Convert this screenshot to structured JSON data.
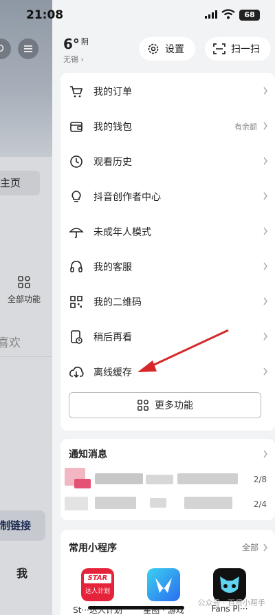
{
  "status_bar": {
    "time": "21:08",
    "battery": "68"
  },
  "left_panel": {
    "main_tab": "主页",
    "all_functions": "全部功能",
    "likes": "喜欢",
    "copy_link": "制链接",
    "me": "我"
  },
  "weather": {
    "temp": "6°",
    "condition": "阴",
    "city": "无锡"
  },
  "header": {
    "settings_label": "设置",
    "scan_label": "扫一扫"
  },
  "menu": {
    "items": [
      {
        "label": "我的订单",
        "extra": "",
        "icon": "cart-icon"
      },
      {
        "label": "我的钱包",
        "extra": "有余额",
        "icon": "wallet-icon"
      },
      {
        "label": "观看历史",
        "extra": "",
        "icon": "clock-icon"
      },
      {
        "label": "抖音创作者中心",
        "extra": "",
        "icon": "bulb-icon"
      },
      {
        "label": "未成年人模式",
        "extra": "",
        "icon": "umbrella-icon"
      },
      {
        "label": "我的客服",
        "extra": "",
        "icon": "headset-icon"
      },
      {
        "label": "我的二维码",
        "extra": "",
        "icon": "qrcode-icon"
      },
      {
        "label": "稍后再看",
        "extra": "",
        "icon": "watch-later-icon"
      },
      {
        "label": "离线缓存",
        "extra": "",
        "icon": "download-cloud-icon"
      }
    ],
    "more_label": "更多功能"
  },
  "notifications": {
    "title": "通知消息",
    "dates": [
      "2/8",
      "2/4"
    ]
  },
  "mini_programs": {
    "title": "常用小程序",
    "all_label": "全部",
    "apps": [
      {
        "label": "St···达人计划",
        "logo_text": "STAR",
        "logo_sub": "达人计划"
      },
      {
        "label": "星图 · 游戏",
        "logo_text": ""
      },
      {
        "label": "Fans Pl···",
        "logo_text": ""
      }
    ]
  },
  "watermark": "公众号 · 百贤小帮手",
  "colors": {
    "accent_red": "#e5243b",
    "arrow_red": "#d62828",
    "card_bg": "#ffffff",
    "page_bg": "#f2f3f5"
  }
}
